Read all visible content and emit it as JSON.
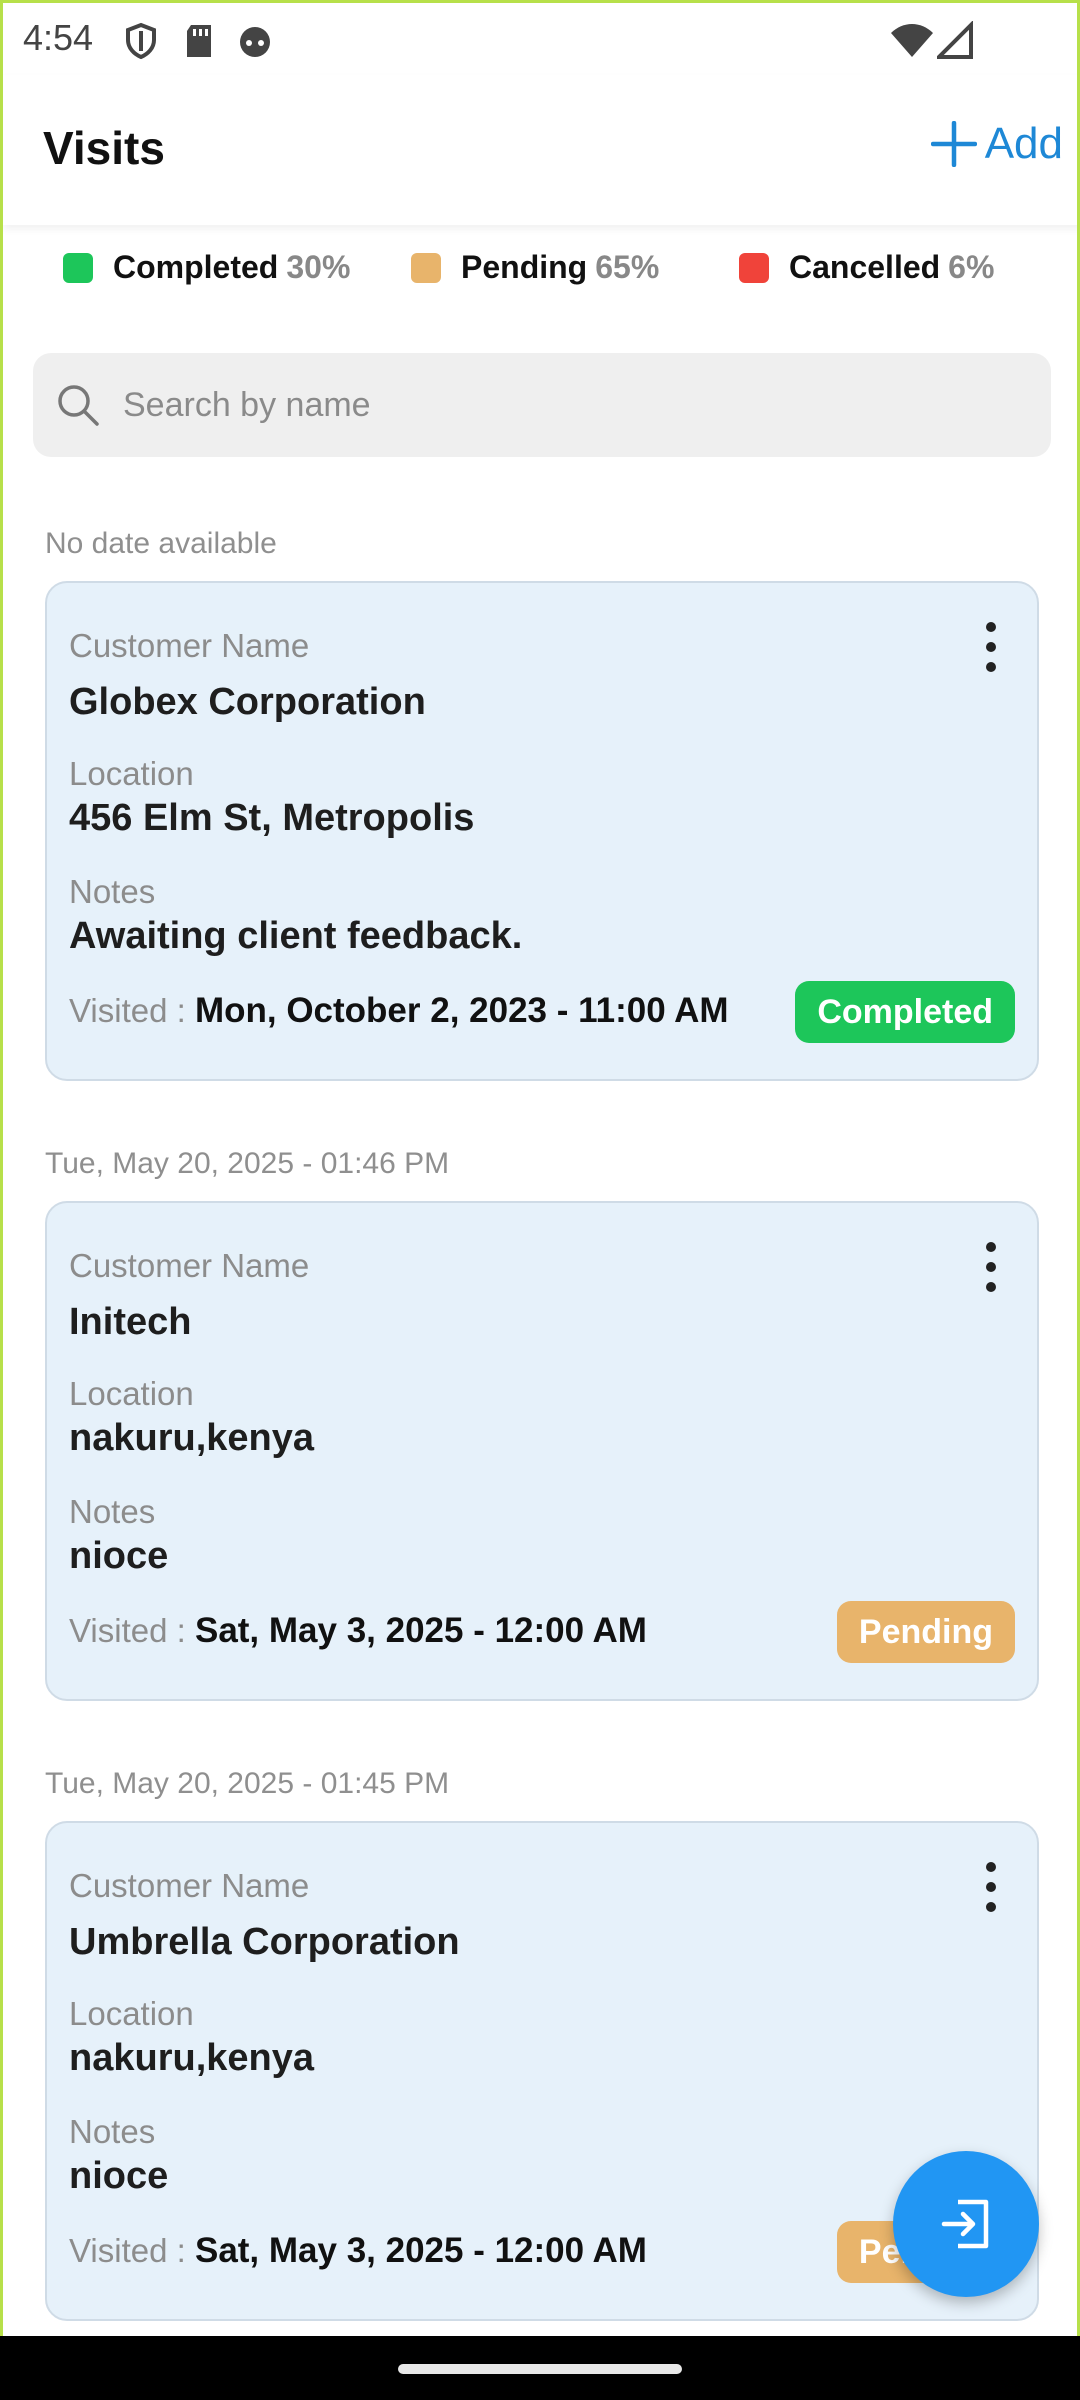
{
  "status_bar": {
    "time": "4:54"
  },
  "header": {
    "title": "Visits",
    "add_label": "Add"
  },
  "legend": [
    {
      "label": "Completed",
      "percent": "30%",
      "color": "#1dc65a"
    },
    {
      "label": "Pending",
      "percent": "65%",
      "color": "#e8b46b"
    },
    {
      "label": "Cancelled",
      "percent": "6%",
      "color": "#f0433a"
    }
  ],
  "search": {
    "placeholder": "Search by name",
    "value": ""
  },
  "labels": {
    "customer_name": "Customer Name",
    "location": "Location",
    "notes": "Notes",
    "visited": "Visited :"
  },
  "status_colors": {
    "Completed": "#1dc65a",
    "Pending": "#e8b46b",
    "Cancelled": "#f0433a"
  },
  "groups": [
    {
      "date": "No date available",
      "visit": {
        "customer": "Globex Corporation",
        "location": "456 Elm St, Metropolis",
        "notes": "Awaiting client feedback.",
        "visited": "Mon, October 2, 2023 - 11:00 AM",
        "status": "Completed"
      }
    },
    {
      "date": "Tue, May 20, 2025 - 01:46 PM",
      "visit": {
        "customer": "Initech",
        "location": "nakuru,kenya",
        "notes": "nioce",
        "visited": "Sat, May 3, 2025 - 12:00 AM",
        "status": "Pending"
      }
    },
    {
      "date": "Tue, May 20, 2025 - 01:45 PM",
      "visit": {
        "customer": "Umbrella Corporation",
        "location": "nakuru,kenya",
        "notes": "nioce",
        "visited": "Sat, May 3, 2025 - 12:00 AM",
        "status": "Pending"
      }
    }
  ],
  "fab": {
    "icon": "exit-to-app-icon"
  }
}
